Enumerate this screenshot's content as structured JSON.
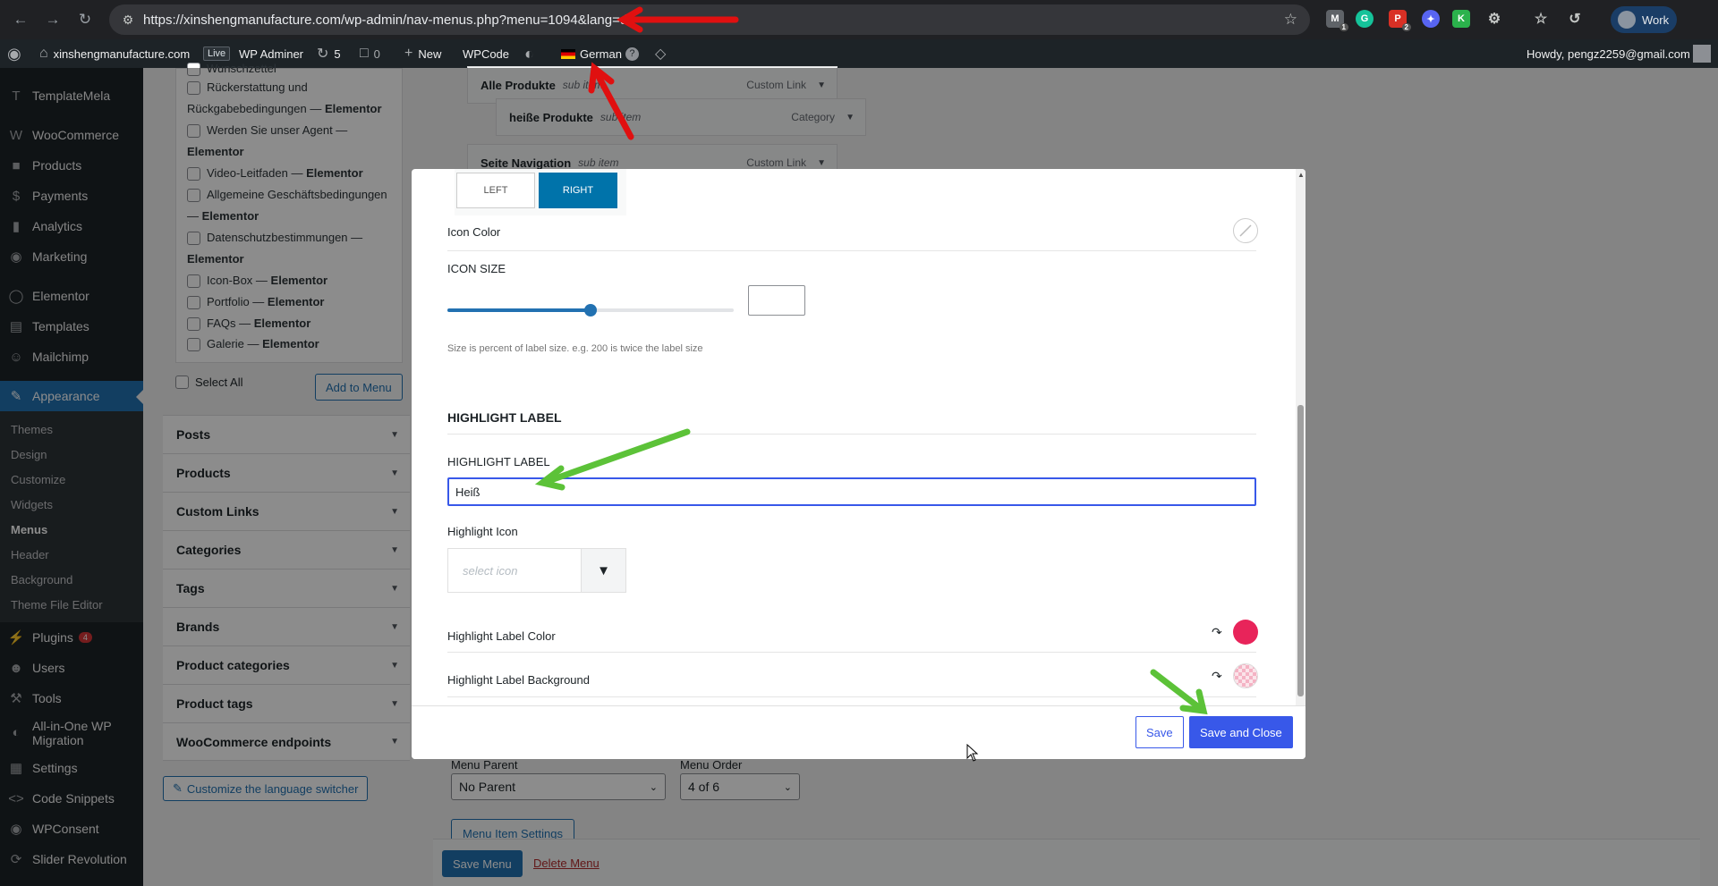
{
  "browser": {
    "url": "https://xinshengmanufacture.com/wp-admin/nav-menus.php?menu=1094&lang=de",
    "profile_label": "Work",
    "extensions": [
      {
        "name": "gmail-ext",
        "badge": "1"
      },
      {
        "name": "grammarly-ext",
        "badge": ""
      },
      {
        "name": "pdf-ext",
        "badge": "2"
      },
      {
        "name": "ai-ext",
        "badge": ""
      },
      {
        "name": "k-ext",
        "badge": ""
      },
      {
        "name": "puzzle-ext",
        "badge": ""
      }
    ]
  },
  "adminbar": {
    "site_name": "xinshengmanufacture.com",
    "live_badge": "Live",
    "wp_adminer": "WP Adminer",
    "updates_count": "5",
    "comments_count": "0",
    "new_label": "New",
    "wpcode_label": "WPCode",
    "language": "German",
    "howdy": "Howdy, pengz2259@gmail.com"
  },
  "sidebar": {
    "items": [
      {
        "label": "TemplateMela",
        "icon": "template-icon"
      },
      {
        "label": "WooCommerce",
        "icon": "woocommerce-icon"
      },
      {
        "label": "Products",
        "icon": "products-icon"
      },
      {
        "label": "Payments",
        "icon": "payments-icon"
      },
      {
        "label": "Analytics",
        "icon": "analytics-icon"
      },
      {
        "label": "Marketing",
        "icon": "marketing-icon"
      },
      {
        "label": "Elementor",
        "icon": "elementor-icon"
      },
      {
        "label": "Templates",
        "icon": "templates-icon"
      },
      {
        "label": "Mailchimp",
        "icon": "mailchimp-icon"
      },
      {
        "label": "Appearance",
        "icon": "appearance-icon"
      }
    ],
    "appearance_sub": [
      "Themes",
      "Design",
      "Customize",
      "Widgets",
      "Menus",
      "Header",
      "Background",
      "Theme File Editor"
    ],
    "bottom_items": [
      {
        "label": "Plugins",
        "icon": "plugins-icon",
        "count": "4"
      },
      {
        "label": "Users",
        "icon": "users-icon"
      },
      {
        "label": "Tools",
        "icon": "tools-icon"
      },
      {
        "label": "All-in-One WP Migration",
        "icon": "migration-icon"
      },
      {
        "label": "Settings",
        "icon": "settings-icon"
      },
      {
        "label": "Code Snippets",
        "icon": "code-snippets-icon"
      },
      {
        "label": "WPConsent",
        "icon": "wpconsent-icon"
      },
      {
        "label": "Slider Revolution",
        "icon": "slider-icon"
      }
    ]
  },
  "pages_panel": {
    "items": [
      {
        "text": "Wunschzettel",
        "suffix": "",
        "checkbox": true
      },
      {
        "text": "Rückerstattung und",
        "suffix": "",
        "checkbox": true
      },
      {
        "text": "Rückgabebedingungen — ",
        "suffix": "Elementor",
        "checkbox": false
      },
      {
        "text": "Werden Sie unser Agent — ",
        "suffix": "",
        "checkbox": true
      },
      {
        "text": "",
        "suffix": "Elementor",
        "checkbox": false
      },
      {
        "text": "Video-Leitfaden — ",
        "suffix": "Elementor",
        "checkbox": true
      },
      {
        "text": "Allgemeine Geschäftsbedingungen",
        "suffix": "",
        "checkbox": true
      },
      {
        "text": "— ",
        "suffix": "Elementor",
        "checkbox": false
      },
      {
        "text": "Datenschutzbestimmungen — ",
        "suffix": "",
        "checkbox": true
      },
      {
        "text": "",
        "suffix": "Elementor",
        "checkbox": false
      },
      {
        "text": "Icon-Box — ",
        "suffix": "Elementor",
        "checkbox": true
      },
      {
        "text": "Portfolio — ",
        "suffix": "Elementor",
        "checkbox": true
      },
      {
        "text": "FAQs — ",
        "suffix": "Elementor",
        "checkbox": true
      },
      {
        "text": "Galerie — ",
        "suffix": "Elementor",
        "checkbox": true
      }
    ],
    "select_all": "Select All",
    "add_to_menu": "Add to Menu"
  },
  "accordions": [
    "Posts",
    "Products",
    "Custom Links",
    "Categories",
    "Tags",
    "Brands",
    "Product categories",
    "Product tags",
    "WooCommerce endpoints"
  ],
  "customize_switcher": "Customize the language switcher",
  "menu_items": [
    {
      "title": "Alle Produkte",
      "sub": "sub item",
      "type": "Custom Link"
    },
    {
      "title": "heiße Produkte",
      "sub": "sub item",
      "type": "Category"
    },
    {
      "title": "Seite Navigation",
      "sub": "sub item",
      "type": "Custom Link"
    }
  ],
  "menu_form": {
    "menu_parent_label": "Menu Parent",
    "menu_parent_value": "No Parent",
    "menu_order_label": "Menu Order",
    "menu_order_value": "4 of 6",
    "menu_item_settings": "Menu Item Settings"
  },
  "footer": {
    "save_menu": "Save Menu",
    "delete_menu": "Delete Menu"
  },
  "modal": {
    "align_left": "LEFT",
    "align_right": "RIGHT",
    "icon_color_label": "Icon Color",
    "icon_size_label": "ICON SIZE",
    "icon_size_percent": 0.5,
    "icon_size_value": "",
    "icon_size_hint": "Size is percent of label size. e.g. 200 is twice the label size",
    "section_title": "HIGHLIGHT LABEL",
    "highlight_label_label": "HIGHLIGHT LABEL",
    "highlight_label_value": "Heiß",
    "highlight_icon_label": "Highlight Icon",
    "highlight_icon_placeholder": "select icon",
    "label_color_label": "Highlight Label Color",
    "label_color": "#e8245a",
    "label_bg_label": "Highlight Label Background",
    "label_bg_color": "#f4b3c4",
    "save": "Save",
    "save_close": "Save and Close"
  },
  "colors": {
    "wp_blue": "#2271b1",
    "modal_accent": "#3858e9",
    "red_arrow": "#e01010",
    "green_arrow": "#5cc238"
  }
}
